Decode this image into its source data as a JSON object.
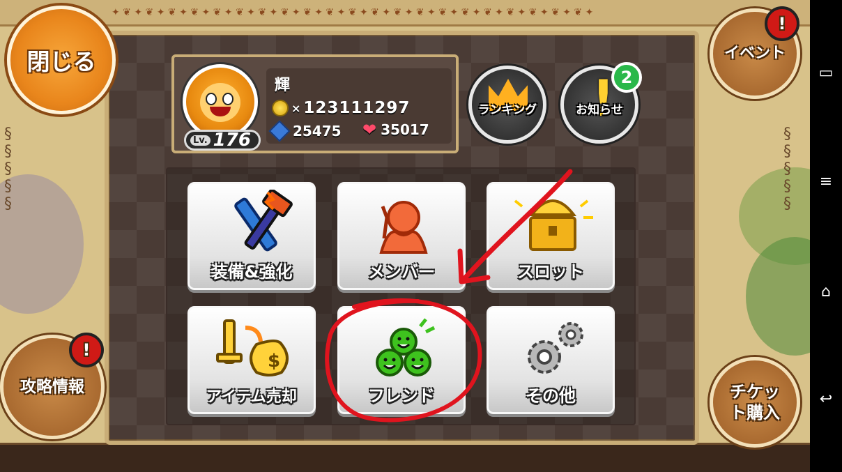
{
  "close_button": {
    "label": "閉じる"
  },
  "player": {
    "name": "輝",
    "level_prefix": "Lv.",
    "level": "176",
    "coins_prefix": "×",
    "coins": "123111297",
    "gems": "25475",
    "hearts": "35017"
  },
  "top_buttons": {
    "ranking": "ランキング",
    "news": "お知らせ",
    "news_count": "2"
  },
  "side_buttons": {
    "event": "イベント",
    "event_alert": "!",
    "strategy": "攻略情報",
    "strategy_alert": "!",
    "ticket": "チケット購入"
  },
  "menu": [
    {
      "label": "装備&強化",
      "icon": "sword-hammer-icon"
    },
    {
      "label": "メンバー",
      "icon": "member-silhouette-icon"
    },
    {
      "label": "スロット",
      "icon": "treasure-chest-icon"
    },
    {
      "label": "アイテム売却",
      "icon": "money-bag-icon"
    },
    {
      "label": "フレンド",
      "icon": "friends-faces-icon"
    },
    {
      "label": "その他",
      "icon": "gears-icon"
    }
  ],
  "colors": {
    "panel": "#4a3b35",
    "panel_border": "#c9ad77",
    "close_button": "#e9861c",
    "annotation_red": "#e0141e",
    "friend_green": "#3ec21e"
  }
}
